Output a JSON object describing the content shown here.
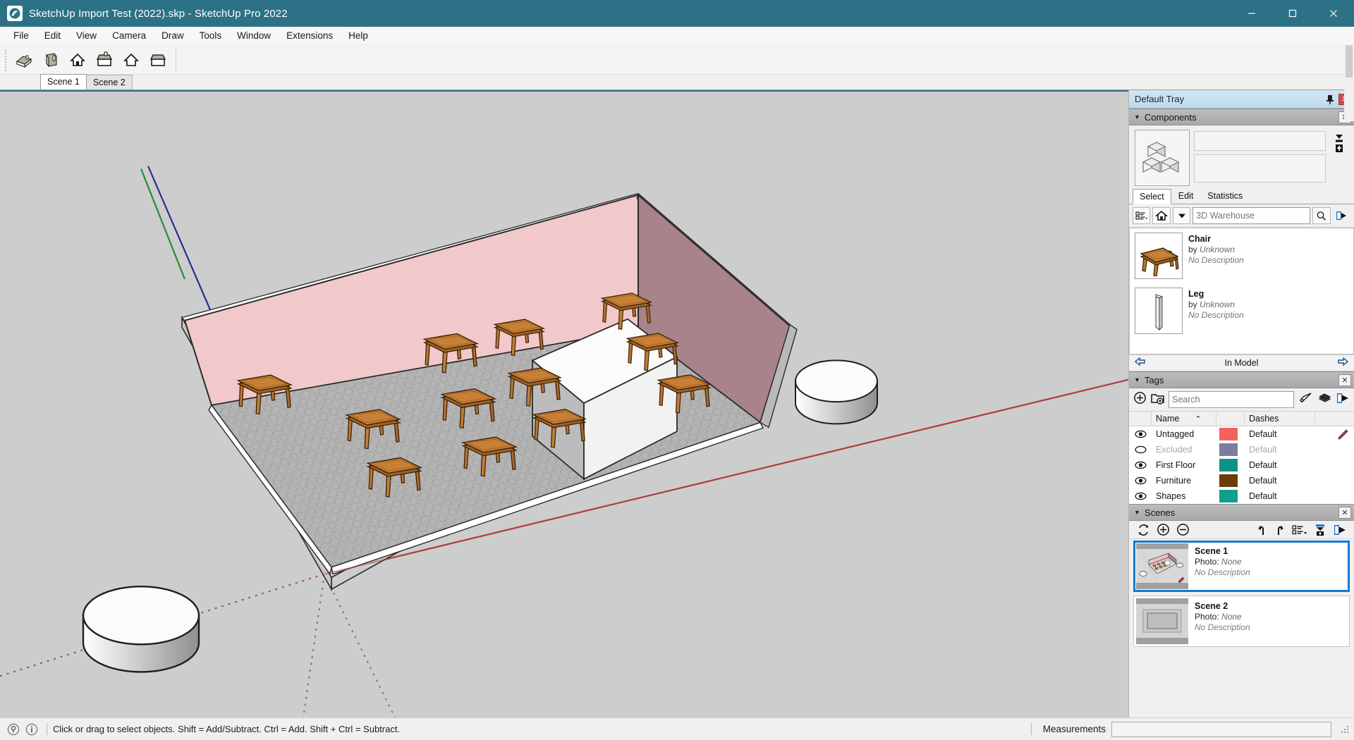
{
  "window": {
    "title": "SketchUp Import Test (2022).skp - SketchUp Pro 2022",
    "app_icon": "sketchup-logo-icon",
    "minimize_label": "–",
    "maximize_label": "□",
    "close_label": "✕",
    "titlebar_color": "#2d7186"
  },
  "menubar": {
    "items": [
      {
        "label": "File"
      },
      {
        "label": "Edit"
      },
      {
        "label": "View"
      },
      {
        "label": "Camera"
      },
      {
        "label": "Draw"
      },
      {
        "label": "Tools"
      },
      {
        "label": "Window"
      },
      {
        "label": "Extensions"
      },
      {
        "label": "Help"
      }
    ]
  },
  "toolbar": {
    "buttons": [
      {
        "name": "iso-view-icon",
        "tooltip": "Iso"
      },
      {
        "name": "top-view-icon",
        "tooltip": "Top"
      },
      {
        "name": "front-view-icon",
        "tooltip": "Front"
      },
      {
        "name": "right-view-icon",
        "tooltip": "Right"
      },
      {
        "name": "back-view-icon",
        "tooltip": "Back"
      },
      {
        "name": "left-view-icon",
        "tooltip": "Left"
      }
    ]
  },
  "scene_tabs": [
    {
      "label": "Scene 1",
      "active": true
    },
    {
      "label": "Scene 2",
      "active": false
    }
  ],
  "tray": {
    "title": "Default Tray",
    "pin_icon": "pin-icon",
    "close_label": "✕",
    "components": {
      "title": "Components",
      "close_label": "✕",
      "caret": "▼",
      "preview_icon": "component-cubes-icon",
      "tabs": [
        {
          "label": "Select",
          "active": true
        },
        {
          "label": "Edit",
          "active": false
        },
        {
          "label": "Statistics",
          "active": false
        }
      ],
      "search": {
        "value": "3D Warehouse",
        "placeholder": "3D Warehouse"
      },
      "nav_icons": [
        "list-view-icon",
        "home-icon",
        "chevron-down-icon",
        "search-icon",
        "open-detail-icon"
      ],
      "items": [
        {
          "name": "Chair",
          "by": "by",
          "author": "Unknown",
          "description": "No Description",
          "thumb": "chair-thumb"
        },
        {
          "name": "Leg",
          "by": "by",
          "author": "Unknown",
          "description": "No Description",
          "thumb": "leg-thumb"
        }
      ],
      "footer": {
        "back_icon": "arrow-left-icon",
        "label": "In Model",
        "forward_icon": "arrow-right-icon"
      }
    },
    "tags": {
      "title": "Tags",
      "close_label": "✕",
      "caret": "▼",
      "toolbar_icons": [
        "add-tag-icon",
        "add-tag-folder-icon",
        "tag-details-icon",
        "tag-layers-icon",
        "tag-export-icon"
      ],
      "search_placeholder": "Search",
      "columns": [
        {
          "label": ""
        },
        {
          "label": "Name",
          "sort": "⌃"
        },
        {
          "label": ""
        },
        {
          "label": "Dashes"
        },
        {
          "label": ""
        }
      ],
      "rows": [
        {
          "visible": true,
          "name": "Untagged",
          "color": "#f4625e",
          "dashes": "Default",
          "active": true,
          "pencil": true
        },
        {
          "visible": false,
          "name": "Excluded",
          "color": "#7b7d9e",
          "dashes": "Default",
          "active": false,
          "pencil": false
        },
        {
          "visible": true,
          "name": "First Floor",
          "color": "#0f9384",
          "dashes": "Default",
          "active": true,
          "pencil": false
        },
        {
          "visible": true,
          "name": "Furniture",
          "color": "#6b3c0b",
          "dashes": "Default",
          "active": true,
          "pencil": false
        },
        {
          "visible": true,
          "name": "Shapes",
          "color": "#0fa08d",
          "dashes": "Default",
          "active": true,
          "pencil": false
        }
      ]
    },
    "scenes": {
      "title": "Scenes",
      "close_label": "✕",
      "caret": "▼",
      "toolbar_icons": [
        "refresh-icon",
        "add-scene-icon",
        "remove-scene-icon",
        "move-scene-up-icon",
        "move-scene-down-icon",
        "scene-view-options-icon",
        "scene-details-icon",
        "scene-export-icon"
      ],
      "items": [
        {
          "name": "Scene 1",
          "photo_label": "Photo:",
          "photo_value": "None",
          "description": "No Description",
          "selected": true
        },
        {
          "name": "Scene 2",
          "photo_label": "Photo:",
          "photo_value": "None",
          "description": "No Description",
          "selected": false
        }
      ]
    }
  },
  "statusbar": {
    "icons": [
      "geo-location-icon",
      "info-icon"
    ],
    "message": "Click or drag to select objects. Shift = Add/Subtract. Ctrl = Add. Shift + Ctrl = Subtract.",
    "measurements_label": "Measurements",
    "measurements_value": "",
    "resize_grip": "resize-grip-icon"
  },
  "viewport": {
    "background": "#cdcdcd",
    "axis_colors": {
      "red": "#c0392b",
      "green": "#2a8a3a",
      "blue": "#2a3ba8"
    },
    "model": {
      "name": "Classroom interior",
      "back_wall_color": "#f0c7c8",
      "right_wall_color": "#ab8288",
      "floor_color": "#b6b6b6",
      "wall_outer_color": "#d4d4d4",
      "box_color": "#f5f5f5",
      "table_top_color": "#c87a33",
      "table_edge_color": "#6b3c0b",
      "table_count": 12,
      "cylinder_count": 2
    }
  }
}
